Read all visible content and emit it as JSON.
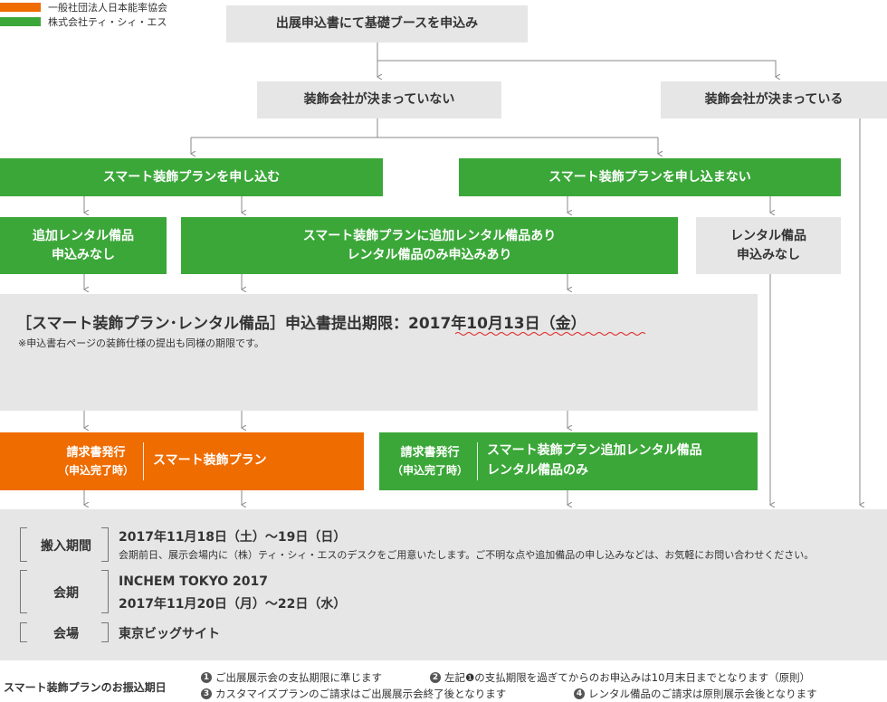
{
  "legend": [
    {
      "label": "一般社団法人日本能率協会",
      "color": "#ef6c00"
    },
    {
      "label": "株式会社ティ・シィ・エス",
      "color": "#3ba739"
    }
  ],
  "flow": {
    "start": "出展申込書にて基礎ブースを申込み",
    "undecided": "装飾会社が決まっていない",
    "decided": "装飾会社が決まっている",
    "smart_apply": "スマート装飾プランを申し込む",
    "smart_no": "スマート装飾プランを申し込まない",
    "add_none": [
      "追加レンタル備品",
      "申込みなし"
    ],
    "add_yes": [
      "スマート装飾プランに追加レンタル備品あり",
      "レンタル備品のみ申込みあり"
    ],
    "rental_none": [
      "レンタル備品",
      "申込みなし"
    ],
    "deadline_title": "［スマート装飾プラン･レンタル備品］申込書提出期限：2017年10月13日（金）",
    "deadline_note": "※申込書右ページの装飾仕様の提出も同様の期限です。",
    "invoice_orange": {
      "left1": "請求書発行",
      "left2": "（申込完了時）",
      "right": "スマート装飾プラン"
    },
    "invoice_green": {
      "left1": "請求書発行",
      "left2": "（申込完了時）",
      "right1": "スマート装飾プラン追加レンタル備品",
      "right2": "レンタル備品のみ"
    }
  },
  "info": {
    "move_in_label": "搬入期間",
    "move_in_value": "2017年11月18日（土）～19日（日）",
    "move_in_note": "会期前日、展示会場内に（株）ティ・シィ・エスのデスクをご用意いたします。ご不明な点や追加備品の申し込みなどは、お気軽にお問い合わせください。",
    "period_label": "会期",
    "period_value1": "INCHEM TOKYO 2017",
    "period_value2": "2017年11月20日（月）～22日（水）",
    "venue_label": "会場",
    "venue_value": "東京ビッグサイト"
  },
  "payment": {
    "label": "スマート装飾プランのお振込期日",
    "items": [
      {
        "num": "1",
        "text": "ご出展展示会の支払期限に準じます"
      },
      {
        "num": "2",
        "text": "左記❶の支払期限を過ぎてからのお申込みは10月末日までとなります（原則）"
      },
      {
        "num": "3",
        "text": "カスタマイズプランのご請求はご出展展示会終了後となります"
      },
      {
        "num": "4",
        "text": "レンタル備品のご請求は原則展示会後となります"
      }
    ]
  },
  "colors": {
    "green": "#3ba739",
    "orange": "#ef6c00",
    "gray": "#e6e6e6",
    "wave": "#e02020"
  }
}
